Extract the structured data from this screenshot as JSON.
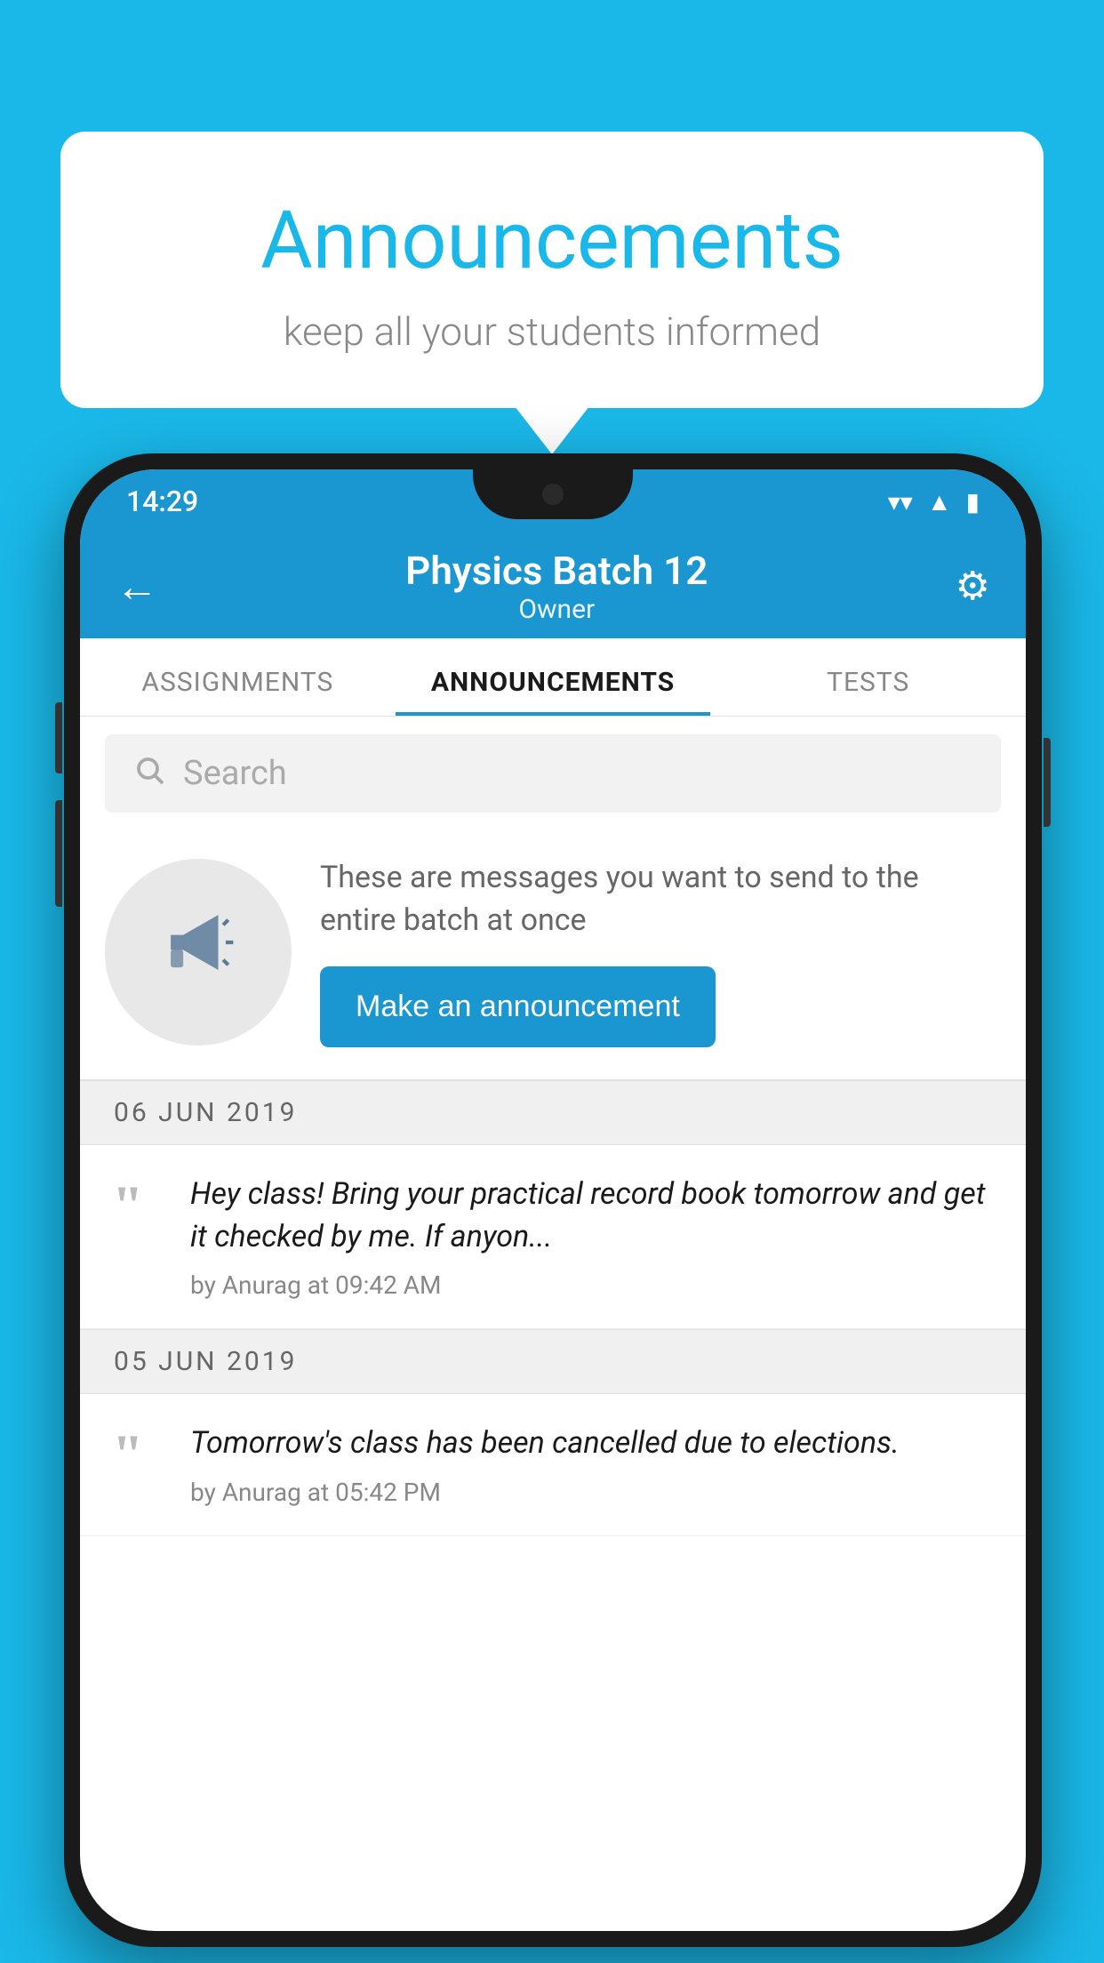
{
  "page": {
    "background_color": "#1ab8e8"
  },
  "speech_bubble": {
    "title": "Announcements",
    "subtitle": "keep all your students informed"
  },
  "phone": {
    "status_bar": {
      "time": "14:29",
      "icons": [
        "wifi",
        "signal",
        "battery"
      ]
    },
    "header": {
      "title": "Physics Batch 12",
      "subtitle": "Owner",
      "back_label": "←",
      "gear_label": "⚙"
    },
    "tabs": [
      {
        "label": "ASSIGNMENTS",
        "active": false
      },
      {
        "label": "ANNOUNCEMENTS",
        "active": true
      },
      {
        "label": "TESTS",
        "active": false
      },
      {
        "label": "...",
        "active": false
      }
    ],
    "search": {
      "placeholder": "Search"
    },
    "promo": {
      "description": "These are messages you want to send to the entire batch at once",
      "button_label": "Make an announcement"
    },
    "announcement_groups": [
      {
        "date": "06  JUN  2019",
        "items": [
          {
            "text": "Hey class! Bring your practical record book tomorrow and get it checked by me. If anyon...",
            "meta": "by Anurag at 09:42 AM"
          }
        ]
      },
      {
        "date": "05  JUN  2019",
        "items": [
          {
            "text": "Tomorrow's class has been cancelled due to elections.",
            "meta": "by Anurag at 05:42 PM"
          }
        ]
      }
    ]
  }
}
